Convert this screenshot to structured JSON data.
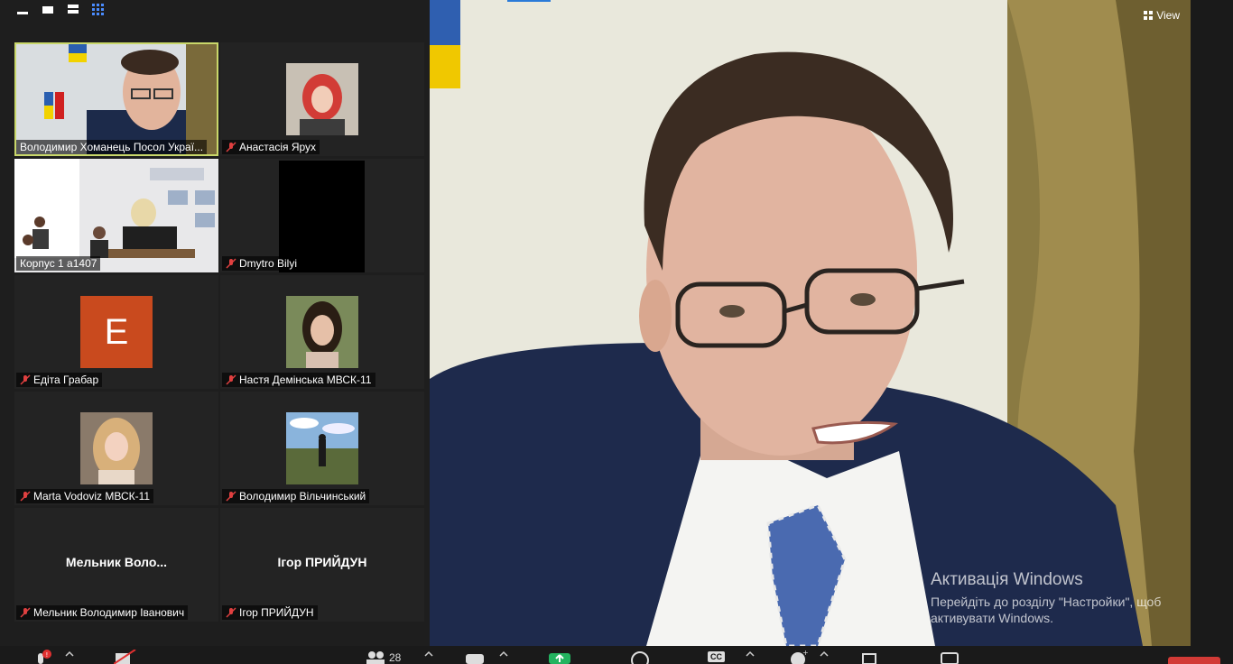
{
  "gallery": {
    "tiles": [
      {
        "label": "Володимир Хоманець Посол Украї..."
      },
      {
        "label": "Анастасія Ярух"
      },
      {
        "label": "Корпус 1 а1407"
      },
      {
        "label": "Dmytro Bilyi"
      },
      {
        "label": "Едіта Грабар",
        "initial": "E"
      },
      {
        "label": "Настя Демінська МВСК-11"
      },
      {
        "label": "Marta Vodoviz МВСК-11"
      },
      {
        "label": "Володимир Вільчинський"
      },
      {
        "label": "Мельник Володимир Іванович",
        "display_name": "Мельник  Воло..."
      },
      {
        "label": "Ігор ПРИЙДУН",
        "display_name": "Ігор ПРИЙДУН"
      }
    ]
  },
  "main": {
    "view_label": "View"
  },
  "watermark": {
    "title": "Активація Windows",
    "line1": "Перейдіть до розділу \"Настройки\", щоб",
    "line2": "активувати Windows."
  },
  "toolbar": {
    "participants_count": "28",
    "cc_label": "CC"
  },
  "colors": {
    "active_border": "#c9d76a",
    "avatar_e": "#c94a1e",
    "accent_green": "#23b35f"
  }
}
